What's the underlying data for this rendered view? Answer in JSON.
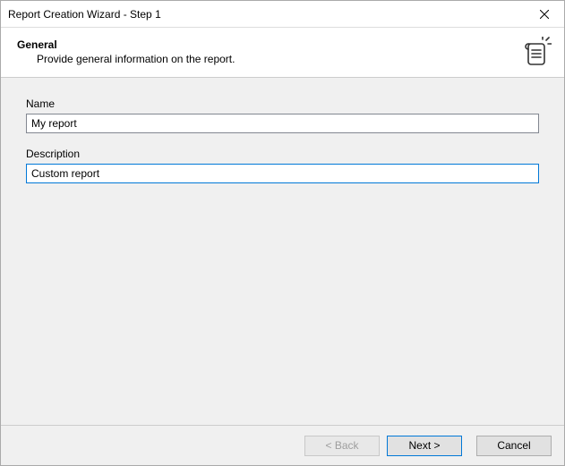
{
  "titlebar": {
    "title": "Report Creation Wizard - Step 1"
  },
  "header": {
    "title": "General",
    "description": "Provide general information on the report."
  },
  "form": {
    "name_label": "Name",
    "name_value": "My report",
    "description_label": "Description",
    "description_value": "Custom report"
  },
  "footer": {
    "back_label": "< Back",
    "next_label": "Next >",
    "cancel_label": "Cancel"
  }
}
